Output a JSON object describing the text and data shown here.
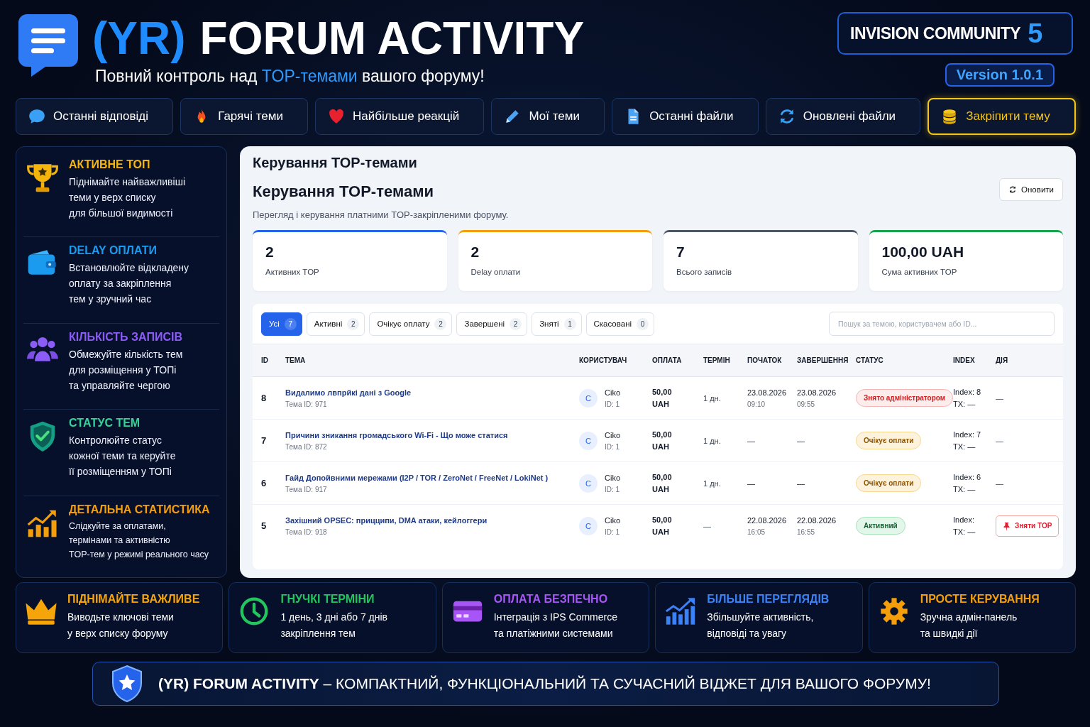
{
  "header": {
    "title_prefix": "(YR)",
    "title": "FORUM ACTIVITY",
    "subtitle": [
      {
        "text": "Повний контроль над ",
        "highlight": false
      },
      {
        "text": "TOP-темами",
        "highlight": true
      },
      {
        "text": " вашого форуму!",
        "highlight": false
      }
    ],
    "platform": "INVISION COMMUNITY",
    "platform_version": "5",
    "version": "Version 1.0.1"
  },
  "nav": [
    {
      "label": "Останні відповіді",
      "selected": false
    },
    {
      "label": "Гарячі теми",
      "selected": false
    },
    {
      "label": "Найбільше реакцій",
      "selected": false
    },
    {
      "label": "Мої теми",
      "selected": false
    },
    {
      "label": "Останні файли",
      "selected": false
    },
    {
      "label": "Оновлені файли",
      "selected": false
    },
    {
      "label": "Закріпити тему",
      "selected": true
    }
  ],
  "sidebar": [
    {
      "title": "АКТИВНЕ ТОП",
      "text": "Піднімайте найважливіші\nтеми у верх списку\nдля більшої видимості",
      "color": "#f5b50a"
    },
    {
      "title": "DELAY ОПЛАТИ",
      "text": "Встановлюйте відкладену\nоплату за закріплення\nтем у зручний час",
      "color": "#1a9bf0"
    },
    {
      "title": "КІЛЬКІСТЬ ЗАПИСІВ",
      "text": "Обмежуйте кількість тем\nдля розміщення у ТОПі\nта управляйте чергою",
      "color": "#8b5cf6"
    },
    {
      "title": "СТАТУС ТЕМ",
      "text": "Контролюйте статус\nкожної теми та керуйте\nїї розміщенням у ТОПі",
      "color": "#34d399"
    },
    {
      "title": "ДЕТАЛЬНА СТАТИСТИКА",
      "text": "Слідкуйте за оплатами,\nтермінами та активністю\nTOP-тем у режимі реального часу",
      "color": "#f59e0b"
    }
  ],
  "panel": {
    "breadcrumb": "Керування TOP-темами",
    "heading": "Керування TOP-темами",
    "description": "Перегляд і керування платними TOP-закріпленими форуму.",
    "refresh_button": "Оновити",
    "stats": [
      {
        "value": "2",
        "label": "Активних TOP",
        "color": "#2563eb"
      },
      {
        "value": "2",
        "label": "Delay оплати",
        "color": "#f59e0b"
      },
      {
        "value": "7",
        "label": "Всього записів",
        "color": "#4b5563"
      },
      {
        "value": "100,00 UAH",
        "label": "Сума активних TOP",
        "color": "#16a34a"
      }
    ],
    "filters": [
      {
        "label": "Усі",
        "count": "7",
        "selected": true
      },
      {
        "label": "Активні",
        "count": "2",
        "selected": false
      },
      {
        "label": "Очікує оплату",
        "count": "2",
        "selected": false
      },
      {
        "label": "Завершені",
        "count": "2",
        "selected": false
      },
      {
        "label": "Зняті",
        "count": "1",
        "selected": false
      },
      {
        "label": "Скасовані",
        "count": "0",
        "selected": false
      }
    ],
    "search": {
      "placeholder": "Пошук за темою, користувачем або ID..."
    },
    "columns": [
      "ID",
      "ТЕМА",
      "КОРИСТУВАЧ",
      "ОПЛАТА",
      "ТЕРМІН",
      "ПОЧАТОК",
      "ЗАВЕРШЕННЯ",
      "СТАТУС",
      "INDEX",
      "ДІЯ"
    ],
    "rows": [
      {
        "id": "8",
        "topic": "Видалимо лвпрйкі дані з Google",
        "topic_id": "Тема ID: 971",
        "avatar": "C",
        "user": "Ciko",
        "user_id": "ID: 1",
        "payment": "50,00 UAH",
        "term": "1 дн.",
        "start_date": "23.08.2026",
        "start_time": "09:10",
        "end_date": "23.08.2026",
        "end_time": "09:55",
        "status": {
          "label": "Знято адміністратором",
          "kind": "removed"
        },
        "index": "Index: 8",
        "tx": "TX: —",
        "action": {
          "kind": "none",
          "label": "—"
        }
      },
      {
        "id": "7",
        "topic": "Причини зникання громадського Wi-Fi - Що може статися",
        "topic_id": "Тема ID: 872",
        "avatar": "C",
        "user": "Ciko",
        "user_id": "ID: 1",
        "payment": "50,00 UAH",
        "term": "1 дн.",
        "start_date": "—",
        "end_date": "—",
        "status": {
          "label": "Очікує оплати",
          "kind": "pending"
        },
        "index": "Index: 7",
        "tx": "TX: —",
        "action": {
          "kind": "none",
          "label": "—"
        }
      },
      {
        "id": "6",
        "topic": "Гайд Допойвними мережами (I2P / TOR / ZeroNet / FreeNet / LokiNet )",
        "topic_id": "Тема ID: 917",
        "avatar": "C",
        "user": "Ciko",
        "user_id": "ID: 1",
        "payment": "50,00 UAH",
        "term": "1 дн.",
        "start_date": "—",
        "end_date": "—",
        "status": {
          "label": "Очікує оплати",
          "kind": "pending"
        },
        "index": "Index: 6",
        "tx": "TX: —",
        "action": {
          "kind": "none",
          "label": "—"
        }
      },
      {
        "id": "5",
        "topic": "Захішний OPSEC: прицципи, DMA атаки, кейлоггери",
        "topic_id": "Тема ID: 918",
        "avatar": "C",
        "user": "Ciko",
        "user_id": "ID: 1",
        "payment": "50,00 UAH",
        "term": "—",
        "start_date": "22.08.2026",
        "start_time": "16:05",
        "end_date": "22.08.2026",
        "end_time": "16:55",
        "status": {
          "label": "Активний",
          "kind": "active"
        },
        "index": "Index:",
        "tx": "TX: —",
        "action": {
          "kind": "button",
          "label": "Зняти TOP"
        }
      }
    ]
  },
  "features": [
    {
      "title": "ПІДНІМАЙТЕ ВАЖЛИВЕ",
      "text": "Виводьте ключові теми\nу верх списку форуму",
      "color": "#f5a50a"
    },
    {
      "title": "ГНУЧКІ ТЕРМІНИ",
      "text": "1 день, 3 дні або 7 днів\nзакріплення тем",
      "color": "#22c55e"
    },
    {
      "title": "ОПЛАТА БЕЗПЕЧНО",
      "text": "Інтеграція з IPS Commerce\nта платіжними системами",
      "color": "#a855f7"
    },
    {
      "title": "БІЛЬШЕ ПЕРЕГЛЯДІВ",
      "text": "Збільшуйте активність,\nвідповіді та увагу",
      "color": "#3b82f6"
    },
    {
      "title": "ПРОСТЕ КЕРУВАННЯ",
      "text": "Зручна адмін-панель\nта швидкі дії",
      "color": "#f59e0b"
    }
  ],
  "footer": "**(YR) FORUM ACTIVITY** – КОМПАКТНИЙ, ФУНКЦІОНАЛЬНИЙ ТА СУЧАСНИЙ ВІДЖЕТ ДЛЯ ВАШОГО ФОРУМУ!"
}
